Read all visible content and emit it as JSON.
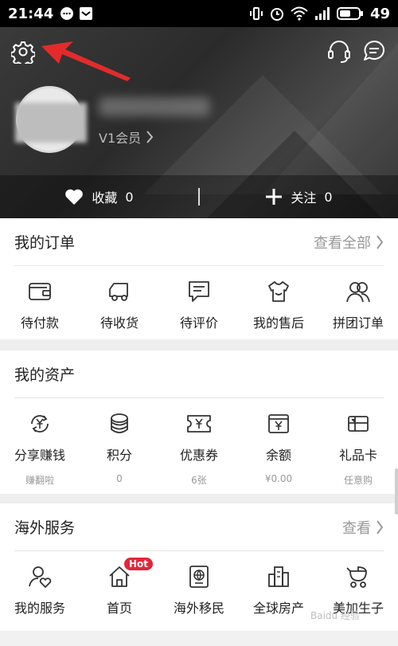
{
  "status_bar": {
    "time": "21:44",
    "battery": "49"
  },
  "profile": {
    "member_level": "V1会员"
  },
  "counts": {
    "favorites_label": "收藏",
    "favorites_count": "0",
    "follow_label": "关注",
    "follow_count": "0"
  },
  "orders": {
    "title": "我的订单",
    "view_all": "查看全部",
    "items": [
      {
        "label": "待付款",
        "icon": "wallet-icon"
      },
      {
        "label": "待收货",
        "icon": "truck-icon"
      },
      {
        "label": "待评价",
        "icon": "comment-icon"
      },
      {
        "label": "我的售后",
        "icon": "shirt-icon"
      },
      {
        "label": "拼团订单",
        "icon": "group-icon"
      }
    ]
  },
  "assets": {
    "title": "我的资产",
    "items": [
      {
        "label": "分享赚钱",
        "sub": "赚翻啦",
        "icon": "yuan-cycle-icon"
      },
      {
        "label": "积分",
        "sub": "0",
        "icon": "coins-icon"
      },
      {
        "label": "优惠券",
        "sub": "6张",
        "icon": "coupon-icon"
      },
      {
        "label": "余额",
        "sub": "¥0.00",
        "icon": "balance-wallet-icon"
      },
      {
        "label": "礼品卡",
        "sub": "任意购",
        "icon": "gift-card-icon"
      }
    ]
  },
  "overseas": {
    "title": "海外服务",
    "view_all": "查看",
    "items": [
      {
        "label": "我的服务",
        "icon": "user-heart-icon"
      },
      {
        "label": "首页",
        "icon": "home-icon",
        "badge": "Hot"
      },
      {
        "label": "海外移民",
        "icon": "passport-icon"
      },
      {
        "label": "全球房产",
        "icon": "buildings-icon"
      },
      {
        "label": "美加生子",
        "icon": "stroller-icon"
      }
    ]
  },
  "watermark": "Baidu 经验",
  "colors": {
    "accent": "#e4253a",
    "arrow": "#e32b2b"
  }
}
